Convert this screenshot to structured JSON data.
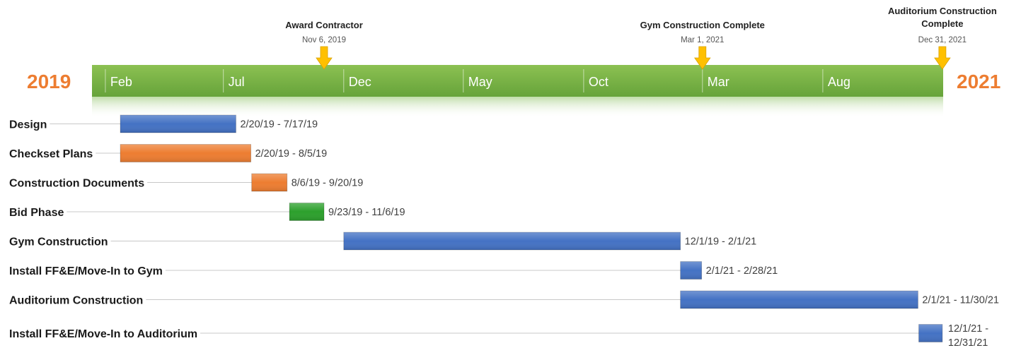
{
  "chart_data": {
    "type": "gantt",
    "start_year_label": "2019",
    "end_year_label": "2021",
    "axis_range": [
      "2019-01-15",
      "2022-01-01"
    ],
    "months": [
      {
        "label": "Feb",
        "date": "2019-02-01"
      },
      {
        "label": "Jul",
        "date": "2019-07-01"
      },
      {
        "label": "Dec",
        "date": "2019-12-01"
      },
      {
        "label": "May",
        "date": "2020-05-01"
      },
      {
        "label": "Oct",
        "date": "2020-10-01"
      },
      {
        "label": "Mar",
        "date": "2021-03-01"
      },
      {
        "label": "Aug",
        "date": "2021-08-01"
      }
    ],
    "milestones": [
      {
        "title": "Award Contractor",
        "date_label": "Nov 6, 2019",
        "date": "2019-11-06"
      },
      {
        "title": "Gym Construction Complete",
        "date_label": "Mar 1, 2021",
        "date": "2021-03-01"
      },
      {
        "title": "Auditorium Construction Complete",
        "date_label": "Dec 31, 2021",
        "date": "2021-12-31"
      }
    ],
    "tasks": [
      {
        "name": "Design",
        "start": "2019-02-20",
        "end": "2019-07-17",
        "range": "2/20/19 - 7/17/19",
        "color": "#4472c4"
      },
      {
        "name": "Checkset Plans",
        "start": "2019-02-20",
        "end": "2019-08-05",
        "range": "2/20/19 - 8/5/19",
        "color": "#ed7d31"
      },
      {
        "name": "Construction Documents",
        "start": "2019-08-06",
        "end": "2019-09-20",
        "range": "8/6/19 - 9/20/19",
        "color": "#ed7d31"
      },
      {
        "name": "Bid Phase",
        "start": "2019-09-23",
        "end": "2019-11-06",
        "range": "9/23/19 - 11/6/19",
        "color": "#2ca02c"
      },
      {
        "name": "Gym Construction",
        "start": "2019-12-01",
        "end": "2021-02-01",
        "range": "12/1/19 - 2/1/21",
        "color": "#4472c4"
      },
      {
        "name": "Install FF&E/Move-In to Gym",
        "start": "2021-02-01",
        "end": "2021-02-28",
        "range": "2/1/21 - 2/28/21",
        "color": "#4472c4"
      },
      {
        "name": "Auditorium Construction",
        "start": "2021-02-01",
        "end": "2021-11-30",
        "range": "2/1/21 - 11/30/21",
        "color": "#4472c4"
      },
      {
        "name": "Install FF&E/Move-In to Auditorium",
        "start": "2021-12-01",
        "end": "2021-12-31",
        "range": "12/1/21 - 12/31/21",
        "range_lines": [
          "12/1/21 -",
          "12/31/21"
        ],
        "color": "#4472c4"
      }
    ],
    "colors": {
      "band": "#70ad47",
      "band_highlight": "#8cc152",
      "year": "#ed7d31",
      "milestone_marker": "#ffc000",
      "connector": "#c8c8c8"
    }
  }
}
